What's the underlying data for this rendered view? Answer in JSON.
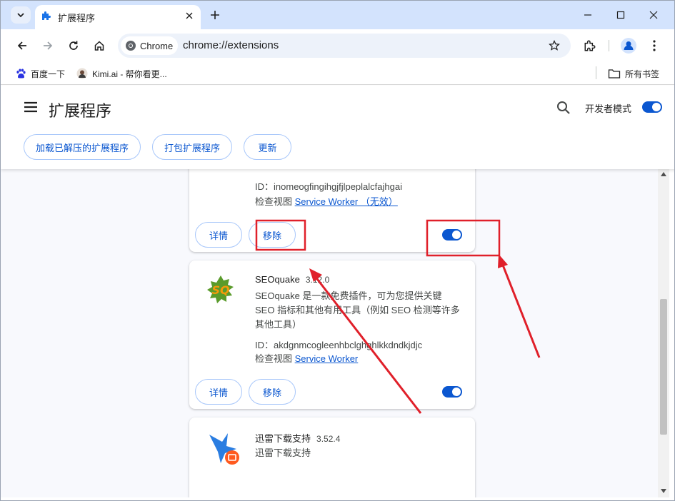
{
  "tab": {
    "title": "扩展程序"
  },
  "omnibox": {
    "chip": "Chrome",
    "url": "chrome://extensions"
  },
  "bookmarks": {
    "items": [
      {
        "label": "百度一下"
      },
      {
        "label": "Kimi.ai - 帮你看更..."
      }
    ],
    "all": "所有书签"
  },
  "header": {
    "title": "扩展程序",
    "dev_mode_label": "开发者模式",
    "dev_mode_on": true,
    "buttons": {
      "load": "加载已解压的扩展程序",
      "pack": "打包扩展程序",
      "update": "更新"
    }
  },
  "cards": [
    {
      "id_label": "ID：",
      "id_value": "inomeogfingihgjfjlpeplalcfajhgai",
      "view_label": "检查视图",
      "view_link": "Service Worker （无效）",
      "details": "详情",
      "remove": "移除",
      "enabled": true
    },
    {
      "name": "SEOquake",
      "version": "3.12.0",
      "description": "SEOquake 是一款免费插件，可为您提供关键 SEO 指标和其他有用工具（例如 SEO 检测等许多其他工具）",
      "id_label": "ID：",
      "id_value": "akdgnmcogleenhbclghghlkkdndkjdjc",
      "view_label": "检查视图",
      "view_link": "Service Worker",
      "details": "详情",
      "remove": "移除",
      "enabled": true,
      "icon": "seoquake-logo"
    },
    {
      "name": "迅雷下载支持",
      "version": "3.52.4",
      "description": "迅雷下载支持",
      "icon": "thunder-logo"
    }
  ],
  "colors": {
    "accent": "#0b57d0",
    "annotation": "#e0202a",
    "tabstrip": "#d3e3fd"
  }
}
